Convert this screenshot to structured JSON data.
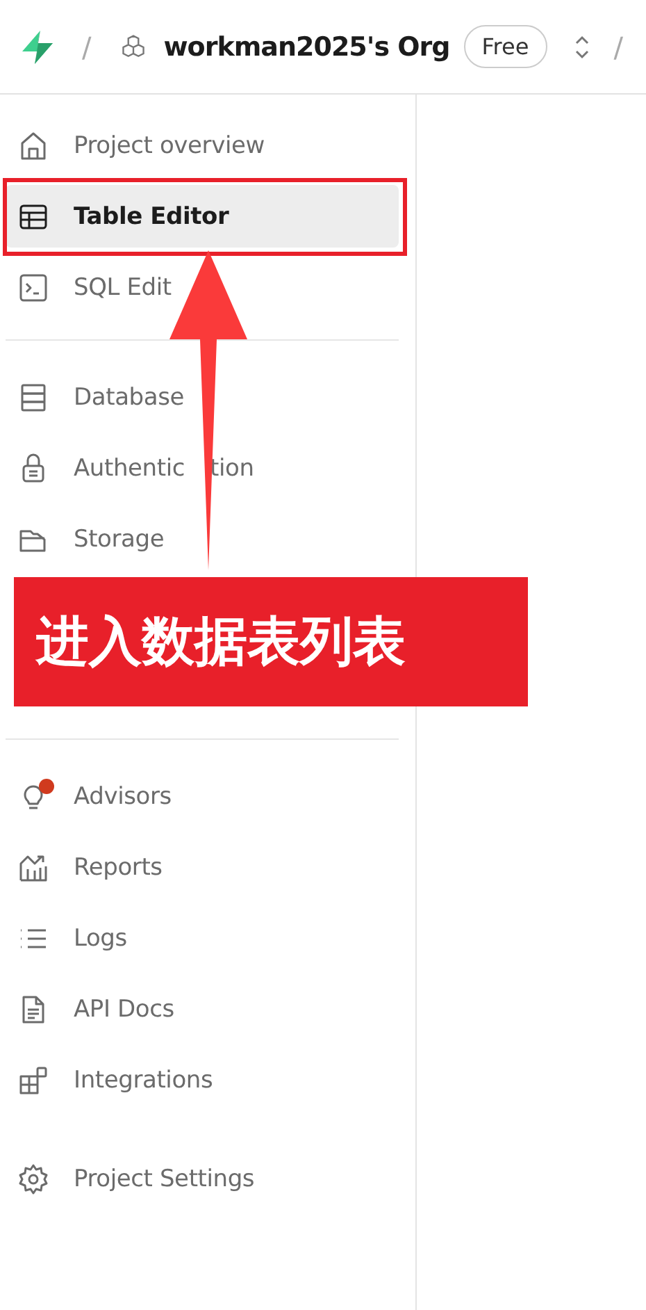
{
  "header": {
    "separators": [
      "/",
      "/"
    ],
    "org_name": "workman2025's Org",
    "plan": "Free"
  },
  "sidebar": {
    "sections": [
      {
        "items": [
          {
            "label": "Project overview",
            "selected": false,
            "badge": false
          },
          {
            "label": "Table Editor",
            "selected": true,
            "badge": false
          },
          {
            "label": "SQL Edit",
            "selected": false,
            "badge": false
          }
        ]
      },
      {
        "items": [
          {
            "label": "Database",
            "selected": false,
            "badge": false
          },
          {
            "label": "Authentic",
            "label_tail": "tion",
            "selected": false,
            "badge": false
          },
          {
            "label": "Storage",
            "selected": false,
            "badge": false
          }
        ]
      },
      {
        "items": [
          {
            "label": "Advisors",
            "selected": false,
            "badge": true
          },
          {
            "label": "Reports",
            "selected": false,
            "badge": false
          },
          {
            "label": "Logs",
            "selected": false,
            "badge": false
          },
          {
            "label": "API Docs",
            "selected": false,
            "badge": false
          },
          {
            "label": "Integrations",
            "selected": false,
            "badge": false
          }
        ]
      },
      {
        "items": [
          {
            "label": "Project Settings",
            "selected": false,
            "badge": false
          }
        ]
      }
    ]
  },
  "annotation": {
    "caption": "进入数据表列表"
  }
}
